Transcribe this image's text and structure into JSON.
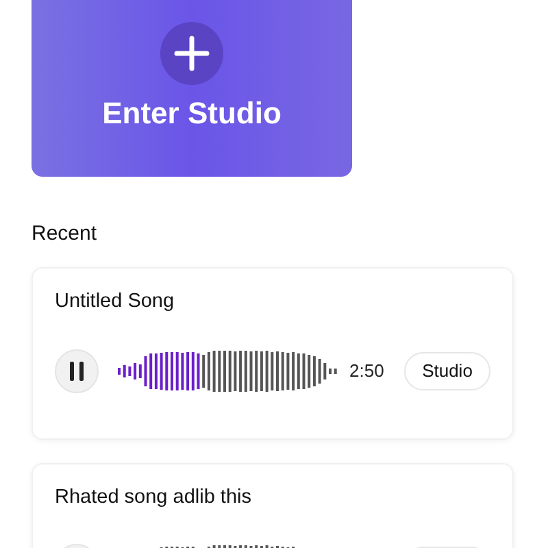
{
  "studio_card": {
    "label": "Enter Studio"
  },
  "section_title": "Recent",
  "recent": [
    {
      "title": "Untitled Song",
      "playing": true,
      "level": 0.38,
      "time": "2:50",
      "button": "Studio"
    },
    {
      "title": "Rhated song adlib this"
    }
  ]
}
